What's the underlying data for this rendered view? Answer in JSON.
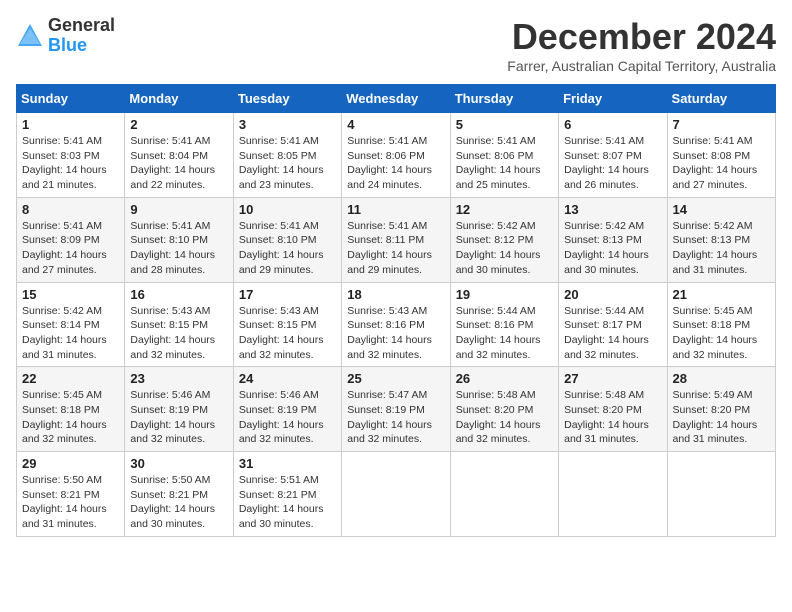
{
  "header": {
    "logo_general": "General",
    "logo_blue": "Blue",
    "month_title": "December 2024",
    "subtitle": "Farrer, Australian Capital Territory, Australia"
  },
  "days_of_week": [
    "Sunday",
    "Monday",
    "Tuesday",
    "Wednesday",
    "Thursday",
    "Friday",
    "Saturday"
  ],
  "weeks": [
    [
      {
        "day": "1",
        "sunrise": "Sunrise: 5:41 AM",
        "sunset": "Sunset: 8:03 PM",
        "daylight": "Daylight: 14 hours and 21 minutes."
      },
      {
        "day": "2",
        "sunrise": "Sunrise: 5:41 AM",
        "sunset": "Sunset: 8:04 PM",
        "daylight": "Daylight: 14 hours and 22 minutes."
      },
      {
        "day": "3",
        "sunrise": "Sunrise: 5:41 AM",
        "sunset": "Sunset: 8:05 PM",
        "daylight": "Daylight: 14 hours and 23 minutes."
      },
      {
        "day": "4",
        "sunrise": "Sunrise: 5:41 AM",
        "sunset": "Sunset: 8:06 PM",
        "daylight": "Daylight: 14 hours and 24 minutes."
      },
      {
        "day": "5",
        "sunrise": "Sunrise: 5:41 AM",
        "sunset": "Sunset: 8:06 PM",
        "daylight": "Daylight: 14 hours and 25 minutes."
      },
      {
        "day": "6",
        "sunrise": "Sunrise: 5:41 AM",
        "sunset": "Sunset: 8:07 PM",
        "daylight": "Daylight: 14 hours and 26 minutes."
      },
      {
        "day": "7",
        "sunrise": "Sunrise: 5:41 AM",
        "sunset": "Sunset: 8:08 PM",
        "daylight": "Daylight: 14 hours and 27 minutes."
      }
    ],
    [
      {
        "day": "8",
        "sunrise": "Sunrise: 5:41 AM",
        "sunset": "Sunset: 8:09 PM",
        "daylight": "Daylight: 14 hours and 27 minutes."
      },
      {
        "day": "9",
        "sunrise": "Sunrise: 5:41 AM",
        "sunset": "Sunset: 8:10 PM",
        "daylight": "Daylight: 14 hours and 28 minutes."
      },
      {
        "day": "10",
        "sunrise": "Sunrise: 5:41 AM",
        "sunset": "Sunset: 8:10 PM",
        "daylight": "Daylight: 14 hours and 29 minutes."
      },
      {
        "day": "11",
        "sunrise": "Sunrise: 5:41 AM",
        "sunset": "Sunset: 8:11 PM",
        "daylight": "Daylight: 14 hours and 29 minutes."
      },
      {
        "day": "12",
        "sunrise": "Sunrise: 5:42 AM",
        "sunset": "Sunset: 8:12 PM",
        "daylight": "Daylight: 14 hours and 30 minutes."
      },
      {
        "day": "13",
        "sunrise": "Sunrise: 5:42 AM",
        "sunset": "Sunset: 8:13 PM",
        "daylight": "Daylight: 14 hours and 30 minutes."
      },
      {
        "day": "14",
        "sunrise": "Sunrise: 5:42 AM",
        "sunset": "Sunset: 8:13 PM",
        "daylight": "Daylight: 14 hours and 31 minutes."
      }
    ],
    [
      {
        "day": "15",
        "sunrise": "Sunrise: 5:42 AM",
        "sunset": "Sunset: 8:14 PM",
        "daylight": "Daylight: 14 hours and 31 minutes."
      },
      {
        "day": "16",
        "sunrise": "Sunrise: 5:43 AM",
        "sunset": "Sunset: 8:15 PM",
        "daylight": "Daylight: 14 hours and 32 minutes."
      },
      {
        "day": "17",
        "sunrise": "Sunrise: 5:43 AM",
        "sunset": "Sunset: 8:15 PM",
        "daylight": "Daylight: 14 hours and 32 minutes."
      },
      {
        "day": "18",
        "sunrise": "Sunrise: 5:43 AM",
        "sunset": "Sunset: 8:16 PM",
        "daylight": "Daylight: 14 hours and 32 minutes."
      },
      {
        "day": "19",
        "sunrise": "Sunrise: 5:44 AM",
        "sunset": "Sunset: 8:16 PM",
        "daylight": "Daylight: 14 hours and 32 minutes."
      },
      {
        "day": "20",
        "sunrise": "Sunrise: 5:44 AM",
        "sunset": "Sunset: 8:17 PM",
        "daylight": "Daylight: 14 hours and 32 minutes."
      },
      {
        "day": "21",
        "sunrise": "Sunrise: 5:45 AM",
        "sunset": "Sunset: 8:18 PM",
        "daylight": "Daylight: 14 hours and 32 minutes."
      }
    ],
    [
      {
        "day": "22",
        "sunrise": "Sunrise: 5:45 AM",
        "sunset": "Sunset: 8:18 PM",
        "daylight": "Daylight: 14 hours and 32 minutes."
      },
      {
        "day": "23",
        "sunrise": "Sunrise: 5:46 AM",
        "sunset": "Sunset: 8:19 PM",
        "daylight": "Daylight: 14 hours and 32 minutes."
      },
      {
        "day": "24",
        "sunrise": "Sunrise: 5:46 AM",
        "sunset": "Sunset: 8:19 PM",
        "daylight": "Daylight: 14 hours and 32 minutes."
      },
      {
        "day": "25",
        "sunrise": "Sunrise: 5:47 AM",
        "sunset": "Sunset: 8:19 PM",
        "daylight": "Daylight: 14 hours and 32 minutes."
      },
      {
        "day": "26",
        "sunrise": "Sunrise: 5:48 AM",
        "sunset": "Sunset: 8:20 PM",
        "daylight": "Daylight: 14 hours and 32 minutes."
      },
      {
        "day": "27",
        "sunrise": "Sunrise: 5:48 AM",
        "sunset": "Sunset: 8:20 PM",
        "daylight": "Daylight: 14 hours and 31 minutes."
      },
      {
        "day": "28",
        "sunrise": "Sunrise: 5:49 AM",
        "sunset": "Sunset: 8:20 PM",
        "daylight": "Daylight: 14 hours and 31 minutes."
      }
    ],
    [
      {
        "day": "29",
        "sunrise": "Sunrise: 5:50 AM",
        "sunset": "Sunset: 8:21 PM",
        "daylight": "Daylight: 14 hours and 31 minutes."
      },
      {
        "day": "30",
        "sunrise": "Sunrise: 5:50 AM",
        "sunset": "Sunset: 8:21 PM",
        "daylight": "Daylight: 14 hours and 30 minutes."
      },
      {
        "day": "31",
        "sunrise": "Sunrise: 5:51 AM",
        "sunset": "Sunset: 8:21 PM",
        "daylight": "Daylight: 14 hours and 30 minutes."
      },
      null,
      null,
      null,
      null
    ]
  ]
}
